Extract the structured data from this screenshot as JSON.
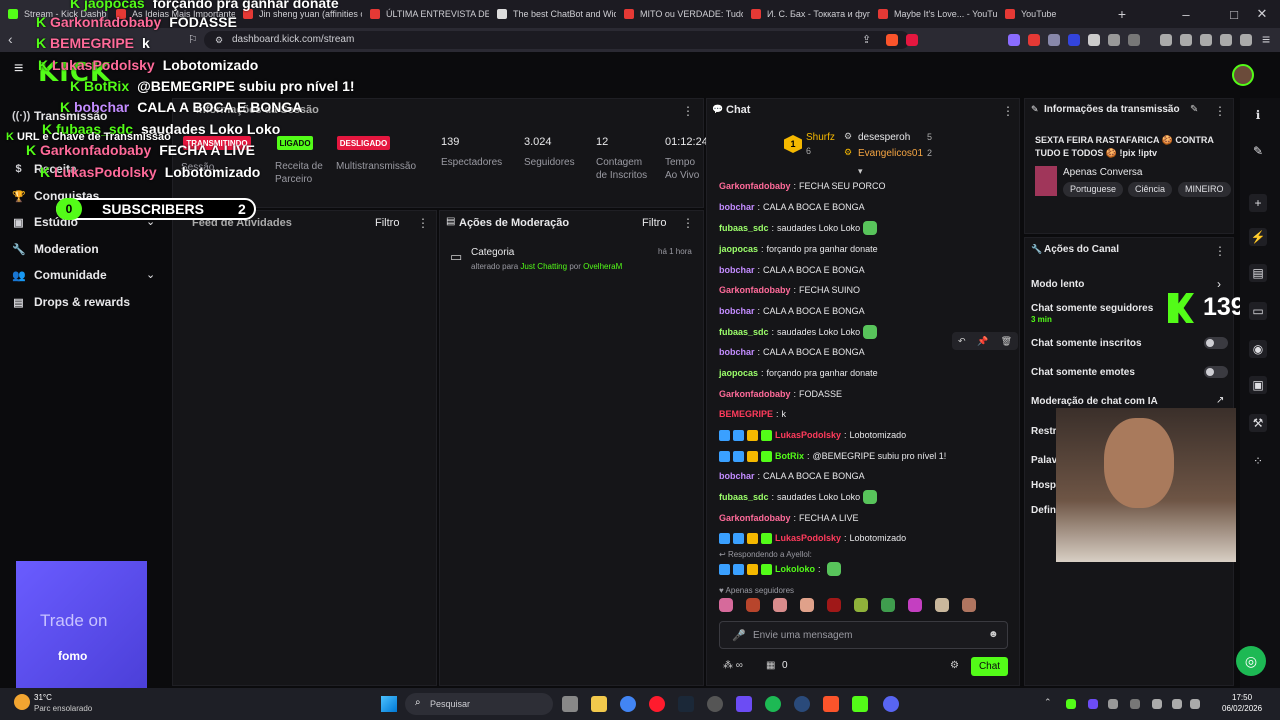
{
  "browser": {
    "tabs": [
      {
        "title": "Stream - Kick Dashb"
      },
      {
        "title": "As Ideias Mais Importante"
      },
      {
        "title": "Jin sheng yuan (affinities o"
      },
      {
        "title": "ÚLTIMA ENTREVISTA DE JE"
      },
      {
        "title": "The best ChatBot and Wid"
      },
      {
        "title": "MITO ou VERDADE: Tudo o"
      },
      {
        "title": "И. С. Бах - Токката и фуга"
      },
      {
        "title": "Maybe It's Love... - YouTub"
      },
      {
        "title": "YouTube"
      }
    ],
    "url": "dashboard.kick.com/stream"
  },
  "logo": "KICK",
  "sidebar": {
    "items": [
      {
        "label": "Transmissão",
        "icon": "broadcast-icon"
      },
      {
        "label": "Receita",
        "icon": "dollar-icon"
      },
      {
        "label": "Conquistas",
        "icon": "trophy-icon"
      },
      {
        "label": "Estúdio",
        "icon": "studio-icon"
      },
      {
        "label": "Moderation",
        "icon": "wrench-icon"
      },
      {
        "label": "Comunidade",
        "icon": "people-icon"
      },
      {
        "label": "Drops & rewards",
        "icon": "gift-icon"
      }
    ],
    "ad_text": "Trade on",
    "ad_brand": "fomo"
  },
  "session": {
    "title": "Informações da Sessão",
    "status_live": "TRANSMITINDO",
    "session_label": "Sessão",
    "receita_status": "LIGADO",
    "receita_label": "Receita de Parceiro",
    "multi_status": "DESLIGADO",
    "multi_label": "Multistransmissão",
    "viewers": "139",
    "viewers_label": "Espectadores",
    "followers": "3.024",
    "followers_label": "Seguidores",
    "subs": "12",
    "subs_label": "Contagem de Inscritos",
    "uptime": "01:12:24",
    "uptime_label": "Tempo Ao Vivo"
  },
  "activity": {
    "title": "Feed de Atividades",
    "filter": "Filtro"
  },
  "modactions": {
    "title": "Ações de Moderação",
    "filter": "Filtro",
    "item_title": "Categoria",
    "item_time": "há 1 hora",
    "item_prefix": "alterado para",
    "item_category": "Just Chatting",
    "item_by": "por",
    "item_user": "OvelheraM"
  },
  "chat": {
    "title": "Chat",
    "top": [
      {
        "user": "Shurfz",
        "count": "6"
      },
      {
        "user": "desesperoh",
        "count": "5"
      },
      {
        "user": "Evangelicos01",
        "count": "2"
      }
    ],
    "messages": [
      {
        "user": "Garkonfadobaby",
        "text": "FECHA SEU PORCO",
        "color": "#ff6b9a"
      },
      {
        "user": "bobchar",
        "text": "CALA A BOCA E BONGA",
        "color": "#c38cff"
      },
      {
        "user": "fubaas_sdc",
        "text": "saudades Loko Loko",
        "color": "#9cff6b"
      },
      {
        "user": "jaopocas",
        "text": "forçando pra ganhar donate",
        "color": "#9cff6b"
      },
      {
        "user": "bobchar",
        "text": "CALA A BOCA E BONGA",
        "color": "#c38cff"
      },
      {
        "user": "Garkonfadobaby",
        "text": "FECHA SUINO",
        "color": "#ff6b9a"
      },
      {
        "user": "bobchar",
        "text": "CALA A BOCA E BONGA",
        "color": "#c38cff"
      },
      {
        "user": "fubaas_sdc",
        "text": "saudades Loko Loko",
        "color": "#9cff6b"
      },
      {
        "user": "bobchar",
        "text": "CALA A BOCA E BONGA",
        "color": "#c38cff"
      },
      {
        "user": "jaopocas",
        "text": "forçando pra ganhar donate",
        "color": "#9cff6b"
      },
      {
        "user": "Garkonfadobaby",
        "text": "FODASSE",
        "color": "#ff6b9a"
      },
      {
        "user": "BEMEGRIPE",
        "text": "k",
        "color": "#ff3b5c"
      },
      {
        "user": "LukasPodolsky",
        "text": "Lobotomizado",
        "color": "#ff3b5c"
      },
      {
        "user": "BotRix",
        "text": "@BEMEGRIPE subiu pro nível 1!",
        "color": "#53fc18"
      },
      {
        "user": "bobchar",
        "text": "CALA A BOCA E BONGA",
        "color": "#c38cff"
      },
      {
        "user": "fubaas_sdc",
        "text": "saudades Loko Loko",
        "color": "#9cff6b"
      },
      {
        "user": "Garkonfadobaby",
        "text": "FECHA A LIVE",
        "color": "#ff6b9a"
      },
      {
        "user": "LukasPodolsky",
        "text": "Lobotomizado",
        "color": "#ff3b5c"
      },
      {
        "user": "Lokoloko",
        "text": "",
        "color": "#53fc18"
      }
    ],
    "reply_to": "Respondendo a Ayellol:",
    "followers_only": "Apenas seguidores",
    "input_placeholder": "Envie uma mensagem",
    "points": "0",
    "send_label": "Chat"
  },
  "streaminfo": {
    "title": "Informações da transmissão",
    "stream_title": "SEXTA FEIRA RASTAFARICA 🍪 CONTRA TUDO E TODOS 🍪 !pix !iptv",
    "category": "Apenas Conversa",
    "tags": [
      "Portuguese",
      "Ciência",
      "MINEIRO"
    ]
  },
  "channel": {
    "title": "Ações do Canal",
    "items": [
      "Modo lento",
      "Chat somente seguidores",
      "Chat somente inscritos",
      "Chat somente emotes",
      "Moderação de chat com IA",
      "Restrição de idad",
      "Palavras banidas",
      "Hospedar Canal",
      "Definir m"
    ],
    "followers_sub": "3 min"
  },
  "overlay": {
    "viewer_count": "139",
    "subs_left": "0",
    "subs_label": "SUBSCRIBERS",
    "subs_right": "2",
    "chat": [
      {
        "user": "jaopocas",
        "text": "forçando pra ganhar donate"
      },
      {
        "user": "Garkonfadobaby",
        "text": "FODASSE"
      },
      {
        "user": "BEMEGRIPE",
        "text": "k"
      },
      {
        "user": "LukasPodolsky",
        "text": "Lobotomizado"
      },
      {
        "user": "BotRix",
        "text": "@BEMEGRIPE subiu pro nível 1!"
      },
      {
        "user": "bobchar",
        "text": "CALA A BOCA E BONGA"
      },
      {
        "user": "fubaas_sdc",
        "text": "saudades Loko Loko"
      },
      {
        "user": "Garkonfadobaby",
        "text": "FECHA A LIVE"
      },
      {
        "user": "LukasPodolsky",
        "text": "Lobotomizado"
      }
    ],
    "key_label": "URL e Chave de Transmissão"
  },
  "taskbar": {
    "temp": "31°C",
    "weather": "Parc ensolarado",
    "search": "Pesquisar",
    "time": "17:50",
    "date": "06/02/2026"
  },
  "colors": {
    "accent": "#53fc18",
    "danger": "#e5173f"
  }
}
